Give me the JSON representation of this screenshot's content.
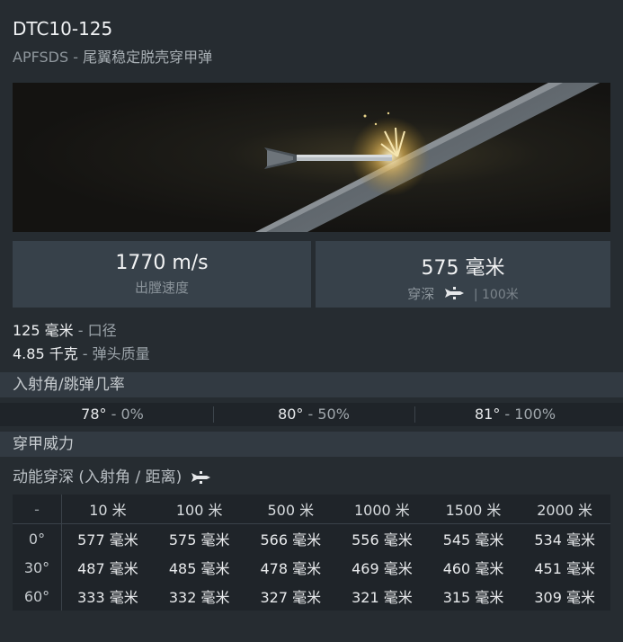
{
  "shell": {
    "title": "DTC10-125",
    "ammo_type": "APFSDS",
    "type_sep": " - ",
    "ammo_desc": "尾翼稳定脱壳穿甲弹"
  },
  "stats": {
    "velocity_value": "1770 m/s",
    "velocity_label": "出膛速度",
    "penetration_value": "575 毫米",
    "penetration_label": "穿深",
    "penetration_range": "| 100米"
  },
  "info": {
    "caliber_value": "125 毫米",
    "caliber_label": " - 口径",
    "mass_value": "4.85 千克",
    "mass_label": " - 弹头质量"
  },
  "ricochet": {
    "title": "入射角/跳弹几率",
    "cells": [
      {
        "angle": "78°",
        "pct": " - 0%"
      },
      {
        "angle": "80°",
        "pct": " - 50%"
      },
      {
        "angle": "81°",
        "pct": " - 100%"
      }
    ]
  },
  "armor_power": {
    "title": "穿甲威力"
  },
  "penetration_table": {
    "caption": "动能穿深 (入射角 / 距离)",
    "corner": "-",
    "distances": [
      "10 米",
      "100 米",
      "500 米",
      "1000 米",
      "1500 米",
      "2000 米"
    ],
    "rows": [
      {
        "angle": "0°",
        "values": [
          "577 毫米",
          "575 毫米",
          "566 毫米",
          "556 毫米",
          "545 毫米",
          "534 毫米"
        ]
      },
      {
        "angle": "30°",
        "values": [
          "487 毫米",
          "485 毫米",
          "478 毫米",
          "469 毫米",
          "460 毫米",
          "451 毫米"
        ]
      },
      {
        "angle": "60°",
        "values": [
          "333 毫米",
          "332 毫米",
          "327 毫米",
          "321 毫米",
          "315 毫米",
          "309 毫米"
        ]
      }
    ]
  },
  "icons": {
    "projectile": "projectile-icon",
    "hero": "apfsds-impact-illustration"
  },
  "colors": {
    "panel": "#262c31",
    "stat_box": "#37414a",
    "section": "#323a42",
    "row": "#1f2429"
  }
}
